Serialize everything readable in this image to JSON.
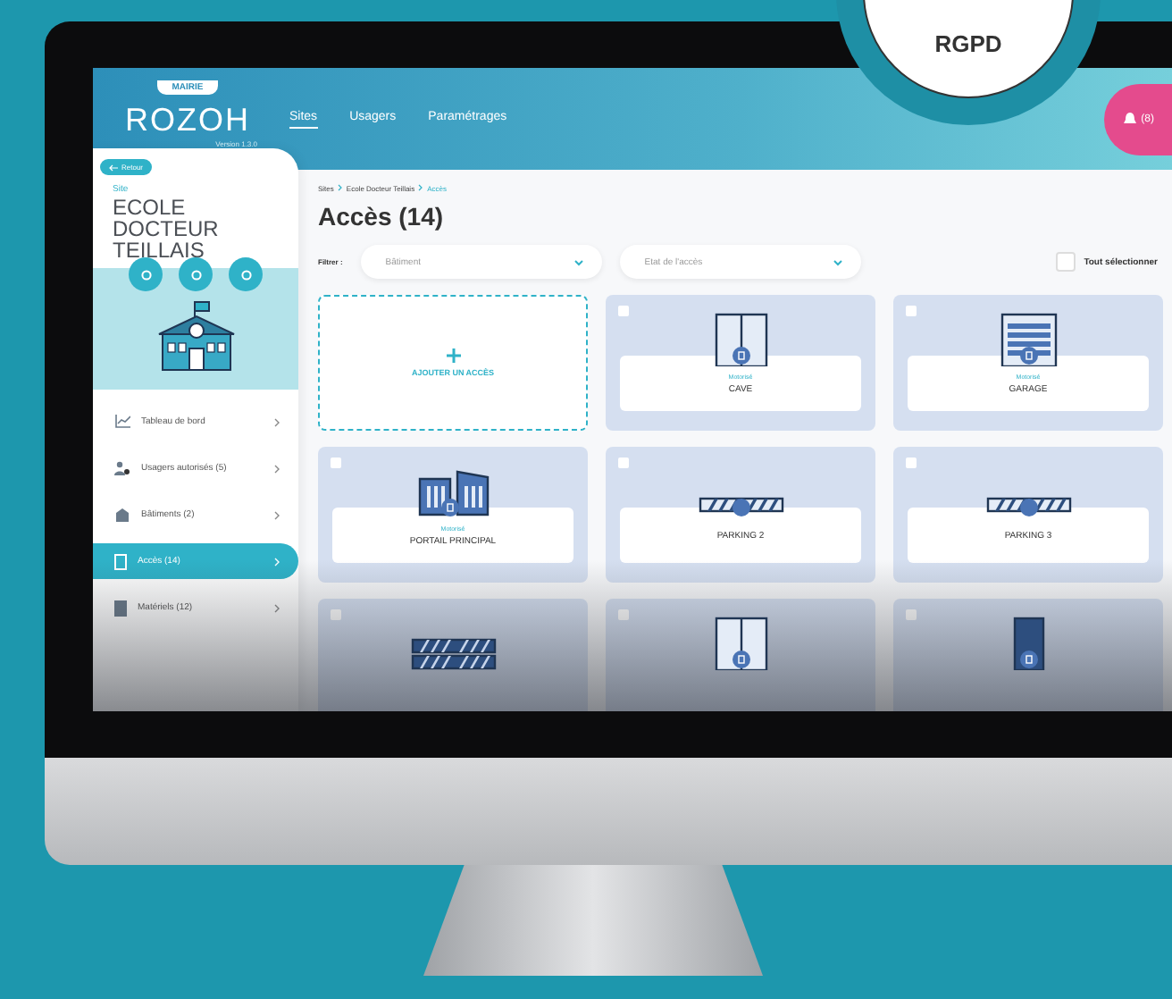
{
  "badge": {
    "label": "RGPD"
  },
  "header": {
    "tag": "MAIRIE",
    "logo": "ROZOH",
    "version": "Version 1.3.0",
    "nav": [
      {
        "label": "Sites",
        "selected": true
      },
      {
        "label": "Usagers",
        "selected": false
      },
      {
        "label": "Paramétrages",
        "selected": false
      }
    ],
    "alerts": "(8)"
  },
  "sidebar": {
    "back": "Retour",
    "site_label": "Site",
    "site_name": "ECOLE DOCTEUR TEILLAIS",
    "items": [
      {
        "kind": "chart",
        "label": "Tableau de bord",
        "selected": false
      },
      {
        "kind": "users",
        "label": "Usagers autorisés (5)",
        "selected": false
      },
      {
        "kind": "building",
        "label": "Bâtiments (2)",
        "selected": false
      },
      {
        "kind": "door",
        "label": "Accès (14)",
        "selected": true
      },
      {
        "kind": "equipment",
        "label": "Matériels (12)",
        "selected": false
      }
    ]
  },
  "main": {
    "breadcrumb": [
      {
        "label": "Sites",
        "current": false
      },
      {
        "label": "Ecole Docteur Teillais",
        "current": false
      },
      {
        "label": "Accès",
        "current": true
      }
    ],
    "title": "Accès (14)",
    "filter_label": "Filtrer :",
    "filters": [
      {
        "placeholder": "Bâtiment"
      },
      {
        "placeholder": "Etat de l'accès"
      }
    ],
    "select_all": {
      "label": "Tout sélectionner",
      "checked": false
    },
    "add_label": "AJOUTER UN ACCÈS",
    "cards": [
      {
        "kind": "double-door",
        "tag": "Motorisé",
        "name": "CAVE",
        "checked": false
      },
      {
        "kind": "garage",
        "tag": "Motorisé",
        "name": "GARAGE",
        "checked": false
      },
      {
        "kind": "gate",
        "tag": "Motorisé",
        "name": "PORTAIL PRINCIPAL",
        "checked": false
      },
      {
        "kind": "barrier",
        "name": "PARKING 2",
        "checked": false
      },
      {
        "kind": "barrier",
        "name": "PARKING 3",
        "checked": false
      },
      {
        "kind": "double-barrier",
        "checked": false
      },
      {
        "kind": "double-door",
        "checked": false
      },
      {
        "kind": "door",
        "checked": false
      }
    ]
  }
}
